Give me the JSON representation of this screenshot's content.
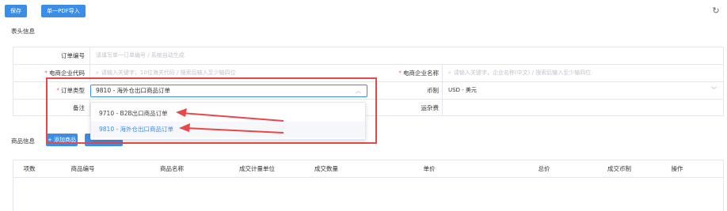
{
  "toolbar": {
    "save_label": "保存",
    "import_label": "单一PDF导入",
    "refresh_icon": "refresh-icon"
  },
  "header_section": {
    "title": "表头信息"
  },
  "form": {
    "order_no": {
      "label": "订单编号",
      "placeholder": "请填写单一订单编号 / 系统自动生成"
    },
    "ecom_code": {
      "label": "电商企业代码",
      "placeholder": "请输入关键字，10位海关代码 / 搜索后输入至少输四位"
    },
    "ecom_name": {
      "label": "电商企业名称",
      "placeholder": "请输入关键字，企业名称(中文) / 搜索后输入至少输四位"
    },
    "order_type": {
      "label": "订单类型",
      "value": "9810 - 海外仓出口商品订单"
    },
    "currency": {
      "label": "币制",
      "value": "USD - 美元"
    },
    "remark": {
      "label": "备注"
    },
    "freight": {
      "label": "运杂费"
    }
  },
  "dropdown": {
    "options": [
      "9710 - B2B出口商品订单",
      "9810 - 海外仓出口商品订单"
    ],
    "selected_index": 1
  },
  "goods_section": {
    "title": "商品信息",
    "add_label": "+ 添加商品"
  },
  "table": {
    "headers": [
      "项数",
      "商品编号",
      "商品名称",
      "成交计量单位",
      "成交数量",
      "单价",
      "总价",
      "成交币制",
      "操作"
    ]
  },
  "colors": {
    "primary": "#3a8ee6",
    "highlight": "#e8484a"
  }
}
